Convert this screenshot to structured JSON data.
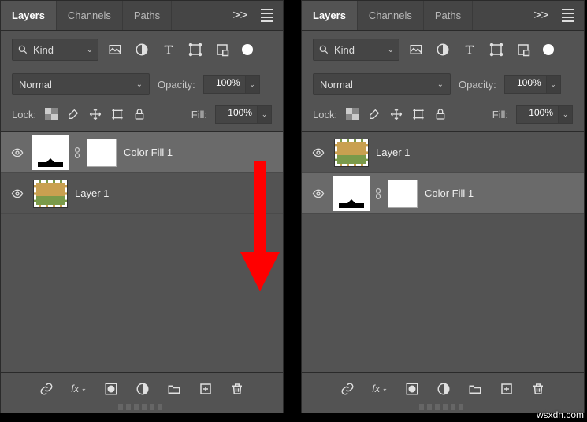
{
  "panels": [
    {
      "tabs": [
        "Layers",
        "Channels",
        "Paths"
      ],
      "active_tab": 0,
      "collapse": ">>",
      "kind_label": "Kind",
      "filter_icons": [
        "image-icon",
        "adjustment-icon",
        "type-icon",
        "shape-icon",
        "smartobject-icon",
        "toggle-icon"
      ],
      "blend_mode": "Normal",
      "opacity_label": "Opacity:",
      "opacity_value": "100%",
      "lock_label": "Lock:",
      "lock_icons": [
        "trans-icon",
        "brush-icon",
        "move-icon",
        "artboard-icon",
        "lock-icon"
      ],
      "fill_label": "Fill:",
      "fill_value": "100%",
      "layers": [
        {
          "name": "Color Fill 1",
          "type": "fill",
          "selected": true
        },
        {
          "name": "Layer 1",
          "type": "image",
          "selected": false
        }
      ],
      "bottom_icons": [
        "link-icon",
        "fx-icon",
        "mask-icon",
        "adjust-icon",
        "group-icon",
        "new-icon",
        "trash-icon"
      ]
    },
    {
      "tabs": [
        "Layers",
        "Channels",
        "Paths"
      ],
      "active_tab": 0,
      "collapse": ">>",
      "kind_label": "Kind",
      "filter_icons": [
        "image-icon",
        "adjustment-icon",
        "type-icon",
        "shape-icon",
        "smartobject-icon",
        "toggle-icon"
      ],
      "blend_mode": "Normal",
      "opacity_label": "Opacity:",
      "opacity_value": "100%",
      "lock_label": "Lock:",
      "lock_icons": [
        "trans-icon",
        "brush-icon",
        "move-icon",
        "artboard-icon",
        "lock-icon"
      ],
      "fill_label": "Fill:",
      "fill_value": "100%",
      "layers": [
        {
          "name": "Layer 1",
          "type": "image",
          "selected": false
        },
        {
          "name": "Color Fill 1",
          "type": "fill",
          "selected": true
        }
      ],
      "bottom_icons": [
        "link-icon",
        "fx-icon",
        "mask-icon",
        "adjust-icon",
        "group-icon",
        "new-icon",
        "trash-icon"
      ]
    }
  ],
  "watermark": "wsxdn.com",
  "arrow_color": "#ff0000"
}
